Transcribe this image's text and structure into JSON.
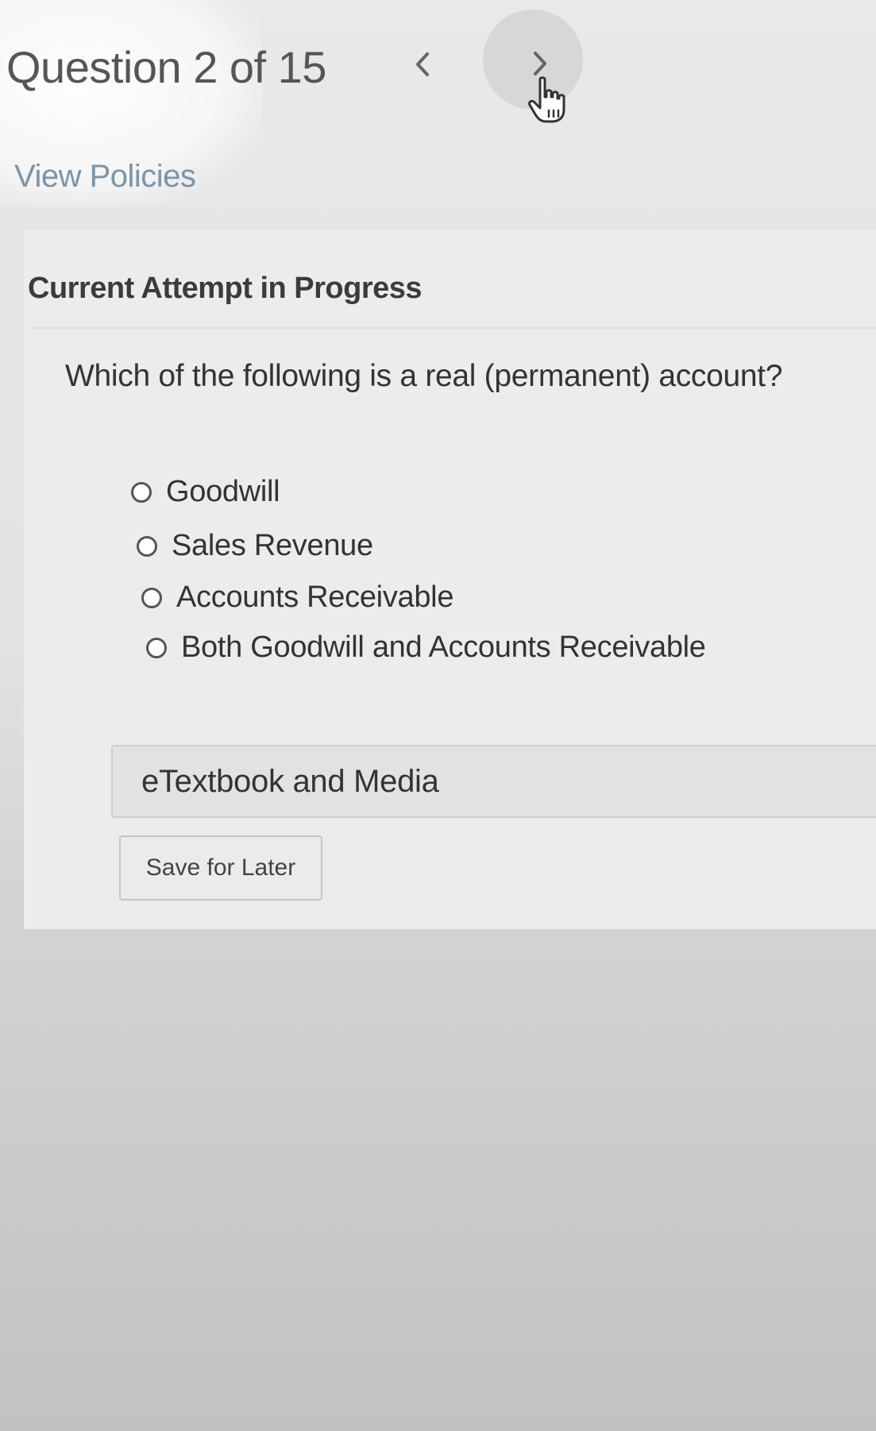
{
  "header": {
    "question_counter": "Question 2 of 15",
    "prev_icon": "chevron-left-icon",
    "next_icon": "chevron-right-icon",
    "prev_glyph": "<",
    "next_glyph": ">"
  },
  "cursor": {
    "icon": "hand-pointer-icon"
  },
  "policies": {
    "link_label": "View Policies"
  },
  "attempt": {
    "heading": "Current Attempt in Progress"
  },
  "question": {
    "text": "Which of the following is a real (permanent) account?",
    "options": [
      {
        "label": "Goodwill",
        "selected": false
      },
      {
        "label": "Sales Revenue",
        "selected": false
      },
      {
        "label": "Accounts Receivable",
        "selected": false
      },
      {
        "label": "Both Goodwill and Accounts Receivable",
        "selected": false
      }
    ]
  },
  "resources": {
    "etextbook_label": "eTextbook and Media"
  },
  "actions": {
    "save_label": "Save for Later"
  },
  "colors": {
    "link": "#7d94a6",
    "text": "#333333",
    "panel": "#e2e2e2"
  }
}
